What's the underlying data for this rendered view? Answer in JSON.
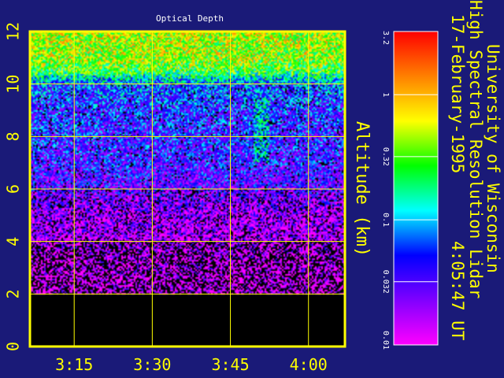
{
  "chart_data": {
    "type": "heatmap",
    "title": "Optical Depth",
    "ylabel": "Altitude (km)",
    "ylim": [
      0,
      12
    ],
    "y_ticks": [
      0,
      2,
      4,
      6,
      8,
      10,
      12
    ],
    "y_tick_labels": [
      "0",
      "2",
      "4",
      "6",
      "8",
      "10",
      "12"
    ],
    "x_ticks": [
      "3:15",
      "3:30",
      "3:45",
      "4:00"
    ],
    "x_tick_minutes": [
      195,
      210,
      225,
      240
    ],
    "xlim_minutes": [
      186.5,
      247
    ],
    "grid": true,
    "no_data_below_km": 2,
    "altitude_profile": [
      {
        "altitude_km": 2,
        "optical_depth": 0.012
      },
      {
        "altitude_km": 3,
        "optical_depth": 0.013
      },
      {
        "altitude_km": 4,
        "optical_depth": 0.016
      },
      {
        "altitude_km": 5,
        "optical_depth": 0.018
      },
      {
        "altitude_km": 6,
        "optical_depth": 0.03
      },
      {
        "altitude_km": 7,
        "optical_depth": 0.04
      },
      {
        "altitude_km": 8,
        "optical_depth": 0.045
      },
      {
        "altitude_km": 9,
        "optical_depth": 0.05
      },
      {
        "altitude_km": 10,
        "optical_depth": 0.07
      },
      {
        "altitude_km": 10.5,
        "optical_depth": 0.3
      },
      {
        "altitude_km": 11,
        "optical_depth": 0.45
      },
      {
        "altitude_km": 12,
        "optical_depth": 0.5
      }
    ],
    "features": [
      {
        "description": "cloud column",
        "time_minutes": 231,
        "altitude_km": [
          7.0,
          9.7
        ],
        "optical_depth": 0.1
      }
    ],
    "colorbar": {
      "scale": "log",
      "range": [
        0.01,
        3.2
      ],
      "tick_values": [
        3.2,
        1,
        0.32,
        0.1,
        0.032,
        0.01
      ],
      "tick_labels": [
        "3.2",
        "1",
        "0.32",
        "0.1",
        "0.032",
        "0.01"
      ],
      "colors": [
        "#ff0000",
        "#ff8000",
        "#ffff00",
        "#00ff00",
        "#00ffff",
        "#0000ff",
        "#8000ff",
        "#ff00ff"
      ]
    }
  },
  "header": {
    "line1": "University of Wisconsin",
    "line2": "High Spectral Resolution Lidar",
    "date": "17-February-1995",
    "time": "4:05:47 UT"
  },
  "colors": {
    "background": "#1a1a78",
    "frame": "#ffff00",
    "text": "#ffff00",
    "title": "#ffffff",
    "no_data": "#000000"
  }
}
